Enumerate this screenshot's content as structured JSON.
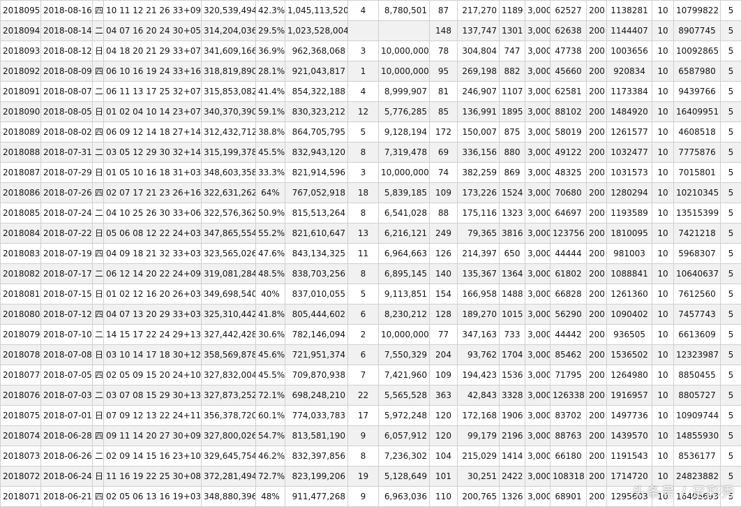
{
  "rows": [
    [
      "2018095",
      "2018-08-16",
      "四",
      "10 11 12 21 26 33+09",
      "320,539,494",
      "42.3%",
      "1,045,113,520",
      "4",
      "8,780,501",
      "87",
      "217,270",
      "1189",
      "3,000",
      "62527",
      "200",
      "1138281",
      "10",
      "10799822",
      "5"
    ],
    [
      "2018094",
      "2018-08-14",
      "二",
      "04 07 16 20 24 30+05",
      "314,204,036",
      "29.5%",
      "1,023,528,004",
      "",
      "",
      "148",
      "137,747",
      "1301",
      "3,000",
      "62638",
      "200",
      "1144407",
      "10",
      "8907745",
      "5"
    ],
    [
      "2018093",
      "2018-08-12",
      "日",
      "04 18 20 21 29 33+07",
      "341,609,166",
      "36.9%",
      "962,368,068",
      "3",
      "10,000,000",
      "78",
      "304,804",
      "747",
      "3,000",
      "47738",
      "200",
      "1003656",
      "10",
      "10092865",
      "5"
    ],
    [
      "2018092",
      "2018-08-09",
      "四",
      "06 10 16 19 24 33+16",
      "318,819,890",
      "28.1%",
      "921,043,817",
      "1",
      "10,000,000",
      "95",
      "269,198",
      "882",
      "3,000",
      "45660",
      "200",
      "920834",
      "10",
      "6587980",
      "5"
    ],
    [
      "2018091",
      "2018-08-07",
      "二",
      "06 11 13 17 25 32+07",
      "315,853,082",
      "41.4%",
      "854,322,188",
      "4",
      "8,999,907",
      "81",
      "246,907",
      "1107",
      "3,000",
      "62581",
      "200",
      "1173384",
      "10",
      "9439766",
      "5"
    ],
    [
      "2018090",
      "2018-08-05",
      "日",
      "01 02 04 10 14 23+07",
      "340,370,390",
      "59.1%",
      "830,323,212",
      "12",
      "5,776,285",
      "85",
      "136,991",
      "1895",
      "3,000",
      "88102",
      "200",
      "1484920",
      "10",
      "16409951",
      "5"
    ],
    [
      "2018089",
      "2018-08-02",
      "四",
      "06 09 12 14 18 27+14",
      "312,432,712",
      "38.8%",
      "864,705,795",
      "5",
      "9,128,194",
      "172",
      "150,007",
      "875",
      "3,000",
      "58019",
      "200",
      "1261577",
      "10",
      "4608518",
      "5"
    ],
    [
      "2018088",
      "2018-07-31",
      "二",
      "03 05 12 29 30 32+14",
      "315,199,378",
      "45.5%",
      "832,943,120",
      "8",
      "7,319,478",
      "69",
      "336,156",
      "880",
      "3,000",
      "49122",
      "200",
      "1032477",
      "10",
      "7775876",
      "5"
    ],
    [
      "2018087",
      "2018-07-29",
      "日",
      "01 05 10 16 18 31+03",
      "348,603,358",
      "33.3%",
      "821,914,596",
      "3",
      "10,000,000",
      "74",
      "382,259",
      "869",
      "3,000",
      "48325",
      "200",
      "1031573",
      "10",
      "7015801",
      "5"
    ],
    [
      "2018086",
      "2018-07-26",
      "四",
      "02 07 17 21 23 26+16",
      "322,631,262",
      "64%",
      "767,052,918",
      "18",
      "5,839,185",
      "109",
      "173,226",
      "1524",
      "3,000",
      "70680",
      "200",
      "1280294",
      "10",
      "10210345",
      "5"
    ],
    [
      "2018085",
      "2018-07-24",
      "二",
      "04 10 25 26 30 33+06",
      "322,576,362",
      "50.9%",
      "815,513,264",
      "8",
      "6,541,028",
      "88",
      "175,116",
      "1323",
      "3,000",
      "64697",
      "200",
      "1193589",
      "10",
      "13515399",
      "5"
    ],
    [
      "2018084",
      "2018-07-22",
      "日",
      "05 06 08 12 22 24+03",
      "347,865,554",
      "55.2%",
      "821,610,647",
      "13",
      "6,216,121",
      "249",
      "79,365",
      "3816",
      "3,000",
      "123756",
      "200",
      "1810095",
      "10",
      "7421218",
      "5"
    ],
    [
      "2018083",
      "2018-07-19",
      "四",
      "04 09 18 21 32 33+03",
      "323,565,026",
      "47.6%",
      "843,134,325",
      "11",
      "6,964,663",
      "126",
      "214,397",
      "650",
      "3,000",
      "44444",
      "200",
      "981003",
      "10",
      "5968307",
      "5"
    ],
    [
      "2018082",
      "2018-07-17",
      "二",
      "06 12 14 20 22 24+09",
      "319,081,284",
      "48.5%",
      "838,703,256",
      "8",
      "6,895,145",
      "140",
      "135,367",
      "1364",
      "3,000",
      "61802",
      "200",
      "1088841",
      "10",
      "10640637",
      "5"
    ],
    [
      "2018081",
      "2018-07-15",
      "日",
      "01 02 12 16 20 26+03",
      "349,698,540",
      "40%",
      "837,010,055",
      "5",
      "9,113,851",
      "154",
      "166,958",
      "1488",
      "3,000",
      "66828",
      "200",
      "1261360",
      "10",
      "7612560",
      "5"
    ],
    [
      "2018080",
      "2018-07-12",
      "四",
      "04 07 13 20 29 33+03",
      "325,310,442",
      "41.8%",
      "805,444,602",
      "6",
      "8,230,212",
      "128",
      "189,270",
      "1015",
      "3,000",
      "56290",
      "200",
      "1090402",
      "10",
      "7457743",
      "5"
    ],
    [
      "2018079",
      "2018-07-10",
      "二",
      "14 15 17 22 24 29+13",
      "327,442,428",
      "30.6%",
      "782,146,094",
      "2",
      "10,000,000",
      "77",
      "347,163",
      "733",
      "3,000",
      "44442",
      "200",
      "936505",
      "10",
      "6613609",
      "5"
    ],
    [
      "2018078",
      "2018-07-08",
      "日",
      "03 10 14 17 18 30+12",
      "358,569,878",
      "45.6%",
      "721,951,374",
      "6",
      "7,550,329",
      "204",
      "93,762",
      "1704",
      "3,000",
      "85462",
      "200",
      "1536502",
      "10",
      "12323987",
      "5"
    ],
    [
      "2018077",
      "2018-07-05",
      "四",
      "02 05 09 15 20 24+10",
      "327,832,004",
      "45.5%",
      "709,870,938",
      "7",
      "7,421,960",
      "109",
      "194,423",
      "1536",
      "3,000",
      "71795",
      "200",
      "1264980",
      "10",
      "8850455",
      "5"
    ],
    [
      "2018076",
      "2018-07-03",
      "二",
      "03 07 08 15 29 30+13",
      "327,873,252",
      "72.1%",
      "698,248,210",
      "22",
      "5,565,528",
      "363",
      "42,843",
      "3328",
      "3,000",
      "126338",
      "200",
      "1916957",
      "10",
      "8805727",
      "5"
    ],
    [
      "2018075",
      "2018-07-01",
      "日",
      "07 09 12 13 22 24+11",
      "356,378,720",
      "60.1%",
      "774,033,783",
      "17",
      "5,972,248",
      "120",
      "172,168",
      "1906",
      "3,000",
      "83702",
      "200",
      "1497736",
      "10",
      "10909744",
      "5"
    ],
    [
      "2018074",
      "2018-06-28",
      "四",
      "09 11 14 20 27 30+09",
      "327,800,026",
      "54.7%",
      "813,581,190",
      "9",
      "6,057,912",
      "120",
      "99,179",
      "2196",
      "3,000",
      "88763",
      "200",
      "1439570",
      "10",
      "14855930",
      "5"
    ],
    [
      "2018073",
      "2018-06-26",
      "二",
      "02 09 14 15 16 23+10",
      "329,645,754",
      "46.2%",
      "832,397,856",
      "8",
      "7,236,302",
      "104",
      "215,029",
      "1414",
      "3,000",
      "66180",
      "200",
      "1191543",
      "10",
      "8536177",
      "5"
    ],
    [
      "2018072",
      "2018-06-24",
      "日",
      "11 16 19 22 25 30+08",
      "372,281,494",
      "72.7%",
      "823,199,206",
      "19",
      "5,128,649",
      "101",
      "30,251",
      "2422",
      "3,000",
      "108318",
      "200",
      "1714720",
      "10",
      "24823882",
      "5"
    ],
    [
      "2018071",
      "2018-06-21",
      "四",
      "02 05 06 13 16 19+03",
      "348,880,396",
      "48%",
      "911,477,268",
      "9",
      "6,963,036",
      "110",
      "200,765",
      "1326",
      "3,000",
      "68901",
      "200",
      "1295603",
      "10",
      "16406693",
      "5"
    ]
  ],
  "watermark": "头条号 / 足彩秀"
}
